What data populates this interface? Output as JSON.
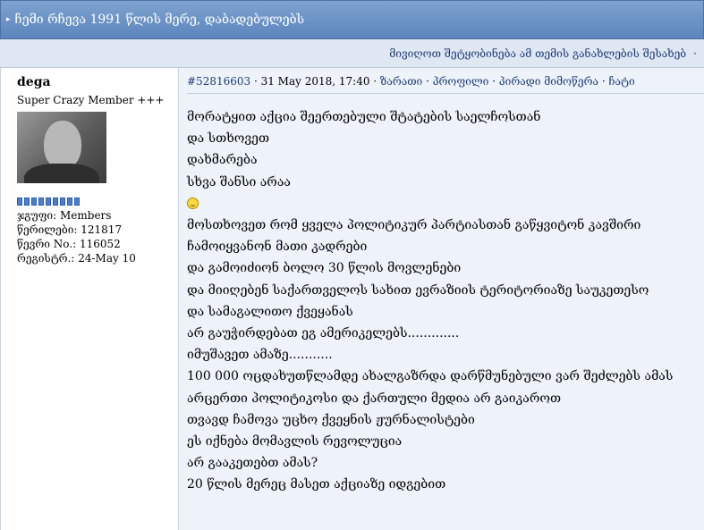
{
  "topic": {
    "title": "ჩემი რჩევა 1991 წლის მერე, დაბადებულებს",
    "arrow_icon": "triangle-right-icon"
  },
  "subbar": {
    "notify_link": "მივიღოთ შეტყობინება ამ თემის განახლების შესახებ",
    "dot": "·"
  },
  "author": {
    "name": "dega",
    "rank": "Super Crazy Member +++",
    "stars_count": 9,
    "group": "ჯგუფი: Members",
    "posts": "წერილები: 121817",
    "member_no": "წევრი No.: 116052",
    "registered": "რეგისტრ.: 24-May 10"
  },
  "meta": {
    "post_id": "#52816603",
    "sep1": " · ",
    "datetime": "31 May 2018, 17:40",
    "sep2": " · ",
    "link_karma": "ზარათი",
    "sep3": " · ",
    "link_profile": "პროფილი",
    "sep4": " · ",
    "link_pm": "პირადი მიმოწერა",
    "sep5": " · ",
    "link_chat": "ჩატი"
  },
  "body": {
    "lines": [
      "მორატყით აქცია შეერთებული შტატების საელჩოსთან",
      "და სთხოვეთ",
      "დახმარება",
      "სხვა შანსი არაა",
      "",
      "მოსთხოვეთ რომ ყველა პოლიტიკურ პარტიასთან გაწყვიტონ კავშირი",
      "ჩამოიყვანონ მათი კადრები",
      "და გამოიძიონ ბოლო 30 წლის მოვლენები",
      "და მიიღებენ საქართველოს სახით ევრაზიის ტერიტორიაზე საუკეთესო",
      "და სამაგალითო ქვეყანას",
      "არ გაუჭირდებათ ეგ ამერიკელებს.............",
      "იმუშავეთ ამაზე...........",
      "100 000 ოცდახუთწლამდე ახალგაზრდა დარწმუნებული ვარ შეძლებს ამას",
      "არცერთი პოლიტიკოსი და ქართული მედია არ გაიკაროთ",
      "თვავდ ჩამოვა უცხო ქვეყნის ჟურნალისტები",
      "ეს იქნება მომავლის რევოლუცია",
      "არ გააკეთებთ ამას?",
      "20 წლის მერეც მასეთ აქციაზე იდგებით"
    ],
    "smiley_icon": "smiley-face-icon"
  },
  "colors": {
    "header_bg": "#5b85bd",
    "subbar_bg": "#dfe7f3",
    "link": "#1c3b75",
    "star": "#4d7fd1"
  }
}
